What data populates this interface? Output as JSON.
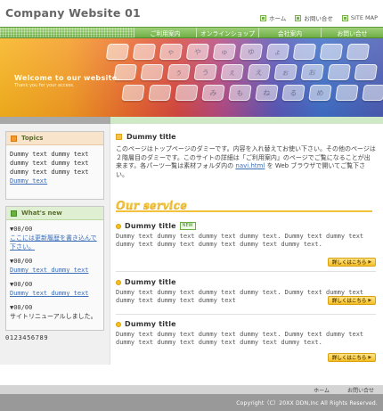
{
  "header": {
    "site_title": "Company Website 01",
    "util_nav": [
      "ホーム",
      "お問い合せ",
      "SITE MAP"
    ]
  },
  "navbar": {
    "items": [
      "ご利用案内",
      "オンラインショップ",
      "会社案内",
      "お問い合せ"
    ]
  },
  "hero": {
    "title": "Welcome to our website.",
    "subtitle": "Thank you for your access.",
    "keys_row1": [
      "",
      "",
      "ゃ",
      "や",
      "ゅ",
      "ゆ",
      "ょ",
      "",
      "",
      ""
    ],
    "keys_row2": [
      "",
      "",
      "ぅ",
      "う",
      "ぇ",
      "え",
      "ぉ",
      "お",
      "",
      ""
    ],
    "keys_row3": [
      "",
      "",
      "",
      "み",
      "も",
      "ね",
      "る",
      "め",
      "",
      ""
    ]
  },
  "sidebar": {
    "topics": {
      "heading": "Topics",
      "text": "Dummy text dummy text dummy text dummy text dummy text dummy text",
      "link": "Dummy text"
    },
    "whats_new": {
      "heading": "What's new",
      "entries": [
        {
          "date": "▼00/00",
          "text": "ここには更新履歴を書き込んで下さい。",
          "is_link": true
        },
        {
          "date": "▼00/00",
          "text": "Dummy text dummy text",
          "is_link": true
        },
        {
          "date": "▼00/00",
          "text": "Dummy text dummy text",
          "is_link": true
        },
        {
          "date": "▼00/00",
          "text": "サイトリニューアルしました。",
          "is_link": false
        }
      ]
    },
    "counter": "0123456789"
  },
  "main": {
    "title": "Dummy title",
    "intro_part1": "このページはトップページのダミーです。内容を入れ替えてお使い下さい。その他のページは２階層目のダミーです。このサイトの詳細は「ご利用案内」のページでご覧になることが出来ます。各パーツ一覧は素材フォルダ内の",
    "intro_link": "navi.html",
    "intro_part2": "を Web ブラウザで開いてご覧下さい。",
    "service_heading": "Our service",
    "services": [
      {
        "title": "Dummy title",
        "badge": "NEW",
        "text": "Dummy text dummy text dummy text dummy text. Dummy text dummy text dummy text dummy text dummy text dummy text dummy text.",
        "button": "詳しくはこちら"
      },
      {
        "title": "Dummy title",
        "badge": "",
        "text": "Dummy text dummy text dummy text dummy text. Dummy text dummy text dummy text dummy text dummy text",
        "button": "詳しくはこちら"
      },
      {
        "title": "Dummy title",
        "badge": "",
        "text": "Dummy text dummy text dummy text dummy text. Dummy text dummy text dummy text dummy text dummy text dummy text dummy text.",
        "button": "詳しくはこちら"
      }
    ]
  },
  "footer": {
    "links": [
      "ホーム",
      "お問い合せ"
    ],
    "copyright": "Copyright（C）20XX DDN,Inc All Rights Reserved."
  },
  "colors": {
    "nav_green": "#6fae46",
    "accent_yellow": "#f2c23a",
    "topics_orange": "#f29a2e",
    "link_blue": "#3d6fb7"
  }
}
